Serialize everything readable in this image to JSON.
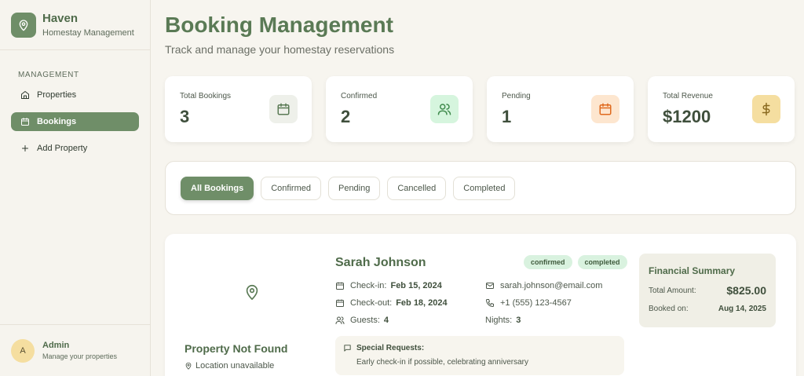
{
  "brand": {
    "title": "Haven",
    "subtitle": "Homestay Management",
    "logo_icon": "map-pin-icon"
  },
  "nav": {
    "heading": "MANAGEMENT",
    "items": [
      {
        "label": "Properties",
        "icon": "home-icon",
        "active": false
      },
      {
        "label": "Bookings",
        "icon": "calendar-icon",
        "active": true
      },
      {
        "label": "Add Property",
        "icon": "plus-icon",
        "active": false
      }
    ]
  },
  "user": {
    "initial": "A",
    "name": "Admin",
    "subtitle": "Manage your properties"
  },
  "page": {
    "title": "Booking Management",
    "subtitle": "Track and manage your homestay reservations"
  },
  "stats": [
    {
      "label": "Total Bookings",
      "value": "3",
      "icon": "calendar-icon",
      "icon_bg": "#eef0ea",
      "icon_color": "#5a7a55"
    },
    {
      "label": "Confirmed",
      "value": "2",
      "icon": "users-icon",
      "icon_bg": "#d6f5de",
      "icon_color": "#3f8a4c"
    },
    {
      "label": "Pending",
      "value": "1",
      "icon": "calendar-icon",
      "icon_bg": "#fde6cf",
      "icon_color": "#e06a1e"
    },
    {
      "label": "Total Revenue",
      "value": "$1200",
      "icon": "dollar-icon",
      "icon_bg": "#f5dea0",
      "icon_color": "#8a6a20"
    }
  ],
  "filters": [
    {
      "label": "All Bookings",
      "active": true
    },
    {
      "label": "Confirmed",
      "active": false
    },
    {
      "label": "Pending",
      "active": false
    },
    {
      "label": "Cancelled",
      "active": false
    },
    {
      "label": "Completed",
      "active": false
    }
  ],
  "booking": {
    "property_name": "Property Not Found",
    "property_location": "Location unavailable",
    "guest_name": "Sarah Johnson",
    "badges": [
      "confirmed",
      "completed"
    ],
    "checkin_label": "Check-in:",
    "checkin": "Feb 15, 2024",
    "checkout_label": "Check-out:",
    "checkout": "Feb 18, 2024",
    "guests_label": "Guests:",
    "guests": "4",
    "email": "sarah.johnson@email.com",
    "phone": "+1 (555) 123-4567",
    "nights_label": "Nights:",
    "nights": "3",
    "requests_title": "Special Requests:",
    "requests_text": "Early check-in if possible, celebrating anniversary",
    "financial": {
      "title": "Financial Summary",
      "total_label": "Total Amount:",
      "total": "$825.00",
      "booked_label": "Booked on:",
      "booked": "Aug 14, 2025"
    }
  },
  "colors": {
    "accent": "#6f8e68",
    "title": "#5a7a55",
    "background": "#f7f5ef"
  }
}
